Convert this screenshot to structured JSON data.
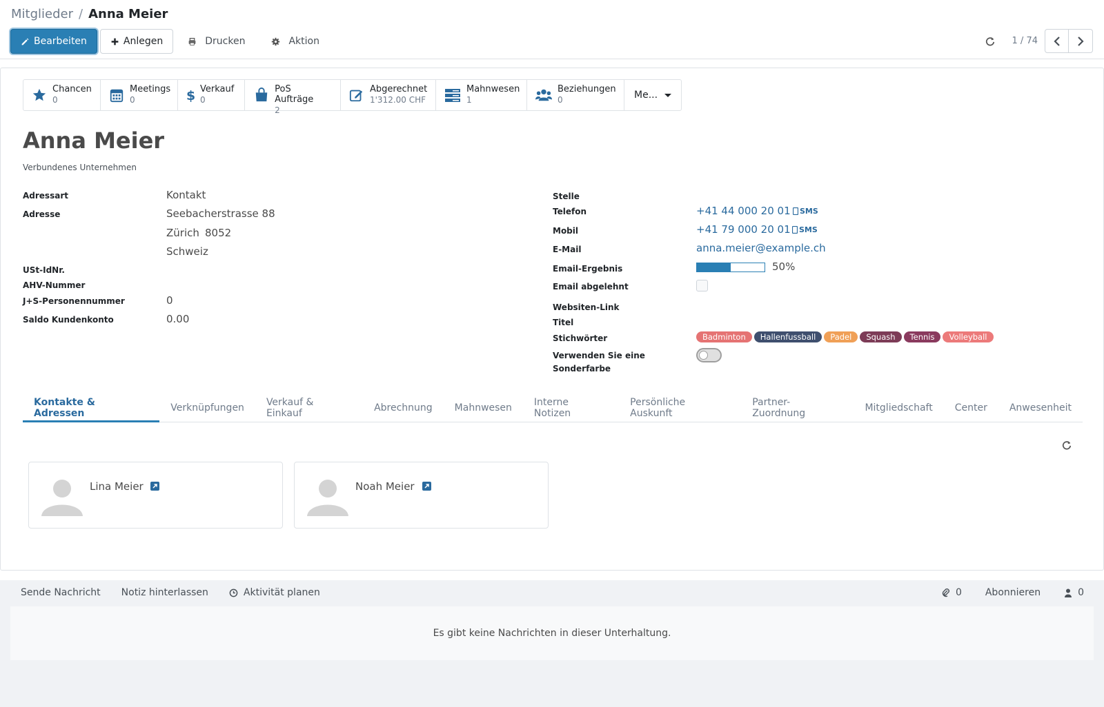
{
  "breadcrumb": {
    "parent": "Mitglieder",
    "separator": "/",
    "current": "Anna Meier"
  },
  "toolbar": {
    "edit": "Bearbeiten",
    "create": "Anlegen",
    "print": "Drucken",
    "action": "Aktion"
  },
  "pager": {
    "value": "1 / 74"
  },
  "stats": [
    {
      "icon": "star-icon",
      "title": "Chancen",
      "value": "0"
    },
    {
      "icon": "calendar-icon",
      "title": "Meetings",
      "value": "0"
    },
    {
      "icon": "dollar-icon",
      "title": "Verkauf",
      "value": "0"
    },
    {
      "icon": "shopping-bag-icon",
      "title": "PoS Aufträge",
      "value": "2"
    },
    {
      "icon": "pencil-square-icon",
      "title": "Abgerechnet",
      "value": "1'312.00 CHF"
    },
    {
      "icon": "list-icon",
      "title": "Mahnwesen",
      "value": "1"
    },
    {
      "icon": "users-icon",
      "title": "Beziehungen",
      "value": "0"
    }
  ],
  "stats_more": "Me...",
  "record": {
    "name": "Anna Meier",
    "company_placeholder": "Verbundenes Unternehmen"
  },
  "left_fields": {
    "address_type": {
      "label": "Adressart",
      "value": "Kontakt"
    },
    "address": {
      "label": "Adresse",
      "street": "Seebacherstrasse 88",
      "city": "Zürich",
      "zip": "8052",
      "country": "Schweiz"
    },
    "vat": {
      "label": "USt-IdNr."
    },
    "ahv": {
      "label": "AHV-Nummer"
    },
    "js": {
      "label": "J+S-Personennummer",
      "value": "0"
    },
    "balance": {
      "label": "Saldo Kundenkonto",
      "value": "0.00"
    }
  },
  "right_fields": {
    "position": {
      "label": "Stelle"
    },
    "phone": {
      "label": "Telefon",
      "value": "+41 44 000 20 01",
      "sms": "SMS"
    },
    "mobile": {
      "label": "Mobil",
      "value": "+41 79 000 20 01",
      "sms": "SMS"
    },
    "email": {
      "label": "E-Mail",
      "value": "anna.meier@example.ch"
    },
    "email_score": {
      "label": "Email-Ergebnis",
      "value": 50,
      "text": "50%"
    },
    "email_declined": {
      "label": "Email abgelehnt",
      "checked": false
    },
    "website": {
      "label": "Websiten-Link"
    },
    "title": {
      "label": "Titel"
    },
    "tags": {
      "label": "Stichwörter",
      "items": [
        {
          "name": "Badminton",
          "color": "#e57373"
        },
        {
          "name": "Hallenfussball",
          "color": "#3f4f6e"
        },
        {
          "name": "Padel",
          "color": "#f0a057"
        },
        {
          "name": "Squash",
          "color": "#7d3c57"
        },
        {
          "name": "Tennis",
          "color": "#8a3a5e"
        },
        {
          "name": "Volleyball",
          "color": "#ec7a7a"
        }
      ]
    },
    "special_color": {
      "label_line1": "Verwenden Sie eine",
      "label_line2": "Sonderfarbe",
      "on": false
    }
  },
  "tabs": [
    "Kontakte & Adressen",
    "Verknüpfungen",
    "Verkauf & Einkauf",
    "Abrechnung",
    "Mahnwesen",
    "Interne Notizen",
    "Persönliche Auskunft",
    "Partner-Zuordnung",
    "Mitgliedschaft",
    "Center",
    "Anwesenheit"
  ],
  "contacts": [
    {
      "name": "Lina Meier"
    },
    {
      "name": "Noah Meier"
    }
  ],
  "chatter": {
    "send": "Sende Nachricht",
    "note": "Notiz hinterlassen",
    "activity": "Aktivität planen",
    "attachments": "0",
    "follow": "Abonnieren",
    "followers": "0",
    "empty": "Es gibt keine Nachrichten in dieser Unterhaltung."
  },
  "colors": {
    "primary": "#2a7fb4",
    "link": "#2a6a9e"
  }
}
